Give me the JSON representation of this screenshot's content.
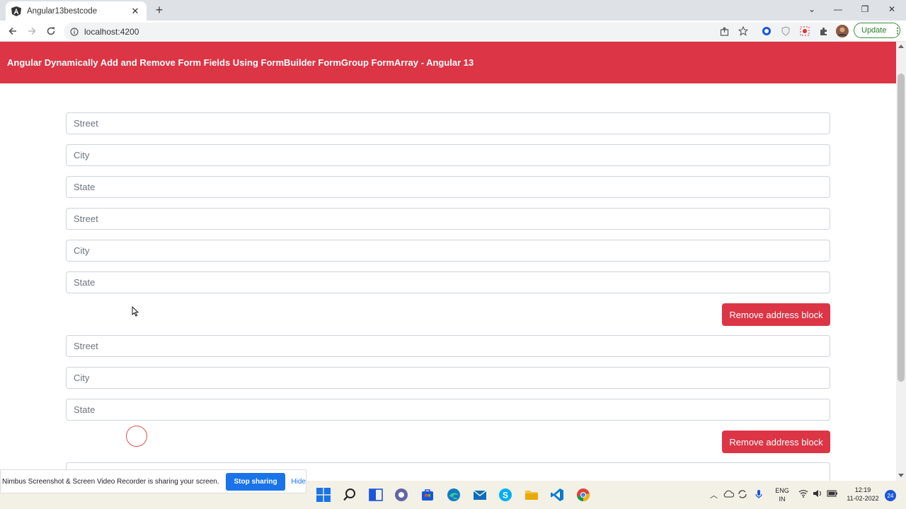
{
  "browser": {
    "tab_title": "Angular13bestcode",
    "tab_close": "✕",
    "new_tab": "+",
    "url": "localhost:4200",
    "update_label": "Update",
    "window_controls": {
      "dropdown": "⌄",
      "minimize": "—",
      "restore": "❐",
      "close": "✕"
    }
  },
  "page": {
    "header_title": "Angular Dynamically Add and Remove Form Fields Using FormBuilder FormGroup FormArray - Angular 13",
    "address_blocks": [
      {
        "street_placeholder": "Street",
        "city_placeholder": "City",
        "state_placeholder": "State",
        "remove_label": ""
      },
      {
        "street_placeholder": "Street",
        "city_placeholder": "City",
        "state_placeholder": "State",
        "remove_label": "Remove address block"
      },
      {
        "street_placeholder": "Street",
        "city_placeholder": "City",
        "state_placeholder": "State",
        "remove_label": "Remove address block"
      }
    ]
  },
  "share_bar": {
    "message": "Nimbus Screenshot & Screen Video Recorder is sharing your screen.",
    "stop_label": "Stop sharing",
    "hide_label": "Hide"
  },
  "taskbar": {
    "lang_top": "ENG",
    "lang_bottom": "IN",
    "time": "12:19",
    "date": "11-02-2022",
    "notification_count": "24"
  },
  "colors": {
    "header_red": "#dc3545",
    "button_red": "#dc3545",
    "share_blue": "#1a73e8"
  }
}
